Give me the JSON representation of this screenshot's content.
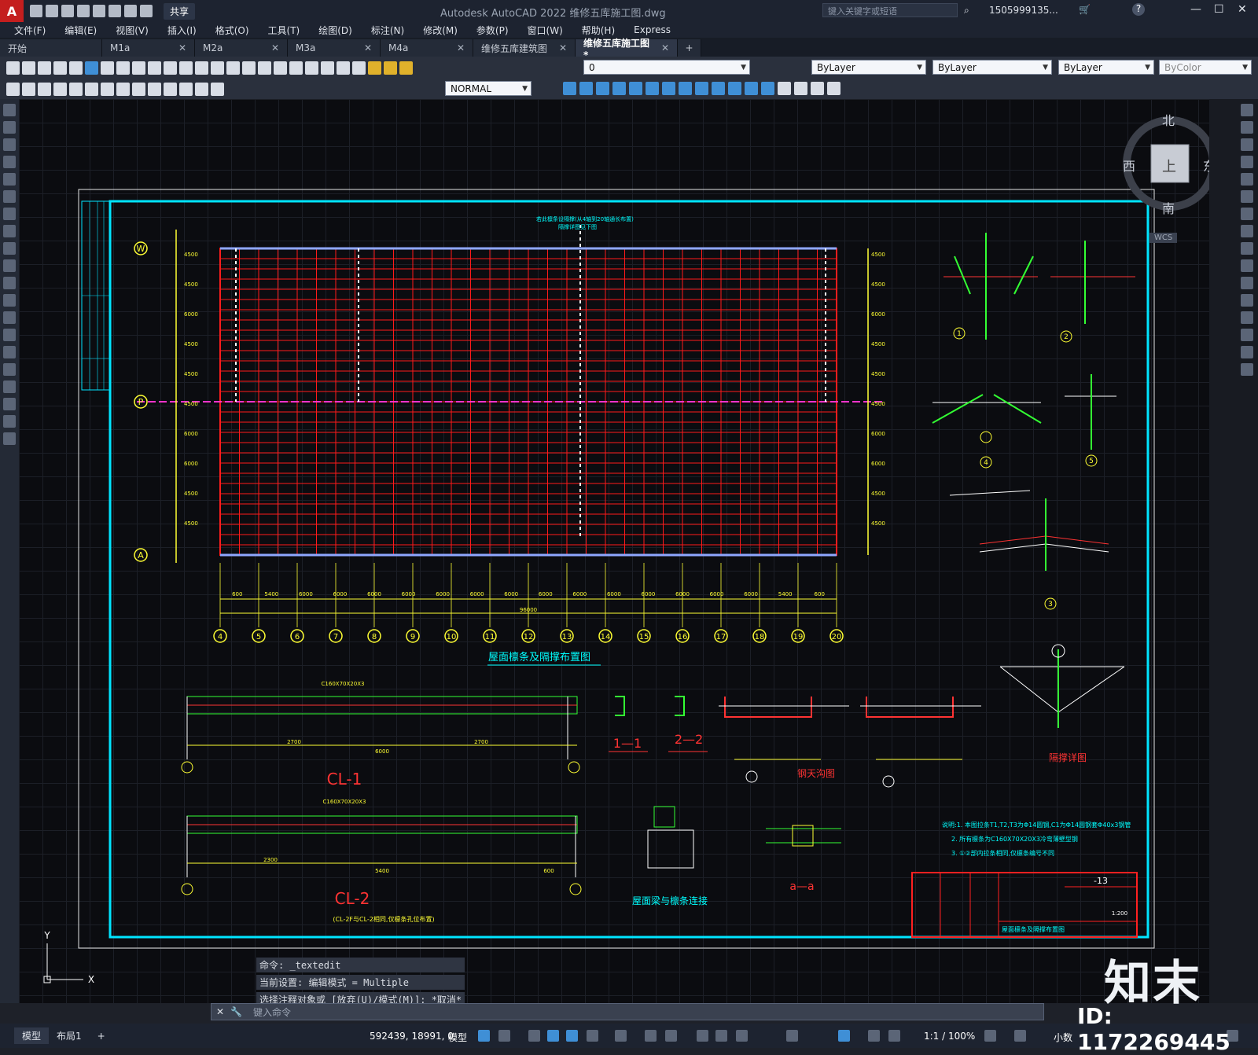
{
  "titlebar": {
    "logo": "A",
    "share": "共享",
    "title": "Autodesk AutoCAD 2022    维修五库施工图.dwg",
    "search_placeholder": "键入关键字或短语",
    "user": "1505999135...",
    "help": "?",
    "minimize": "—",
    "maximize": "☐",
    "close": "✕"
  },
  "menu": [
    "文件(F)",
    "编辑(E)",
    "视图(V)",
    "插入(I)",
    "格式(O)",
    "工具(T)",
    "绘图(D)",
    "标注(N)",
    "修改(M)",
    "参数(P)",
    "窗口(W)",
    "帮助(H)",
    "Express"
  ],
  "tabs": [
    {
      "label": "开始",
      "closable": false,
      "active": false
    },
    {
      "label": "M1a",
      "closable": true,
      "active": false
    },
    {
      "label": "M2a",
      "closable": true,
      "active": false
    },
    {
      "label": "M3a",
      "closable": true,
      "active": false
    },
    {
      "label": "M4a",
      "closable": true,
      "active": false
    },
    {
      "label": "维修五库建筑图",
      "closable": true,
      "active": false
    },
    {
      "label": "维修五库施工图*",
      "closable": true,
      "active": true
    }
  ],
  "new_tab": "+",
  "toolbar": {
    "layer": "0",
    "color": "ByLayer",
    "linetype": "ByLayer",
    "lineweight": "ByLayer",
    "plotstyle": "ByColor",
    "dimstyle": "NORMAL"
  },
  "viewcube": {
    "north": "北",
    "south": "南",
    "east": "东",
    "west": "西",
    "top": "上",
    "wcs": "WCS"
  },
  "drawing": {
    "plan_title": "屋面檩条及隔撑布置图",
    "grid_rows": [
      "W",
      "P",
      "A"
    ],
    "grid_cols": [
      "4",
      "5",
      "6",
      "7",
      "8",
      "9",
      "10",
      "11",
      "12",
      "13",
      "14",
      "15",
      "16",
      "17",
      "18",
      "19",
      "20"
    ],
    "bay_dims": [
      "600",
      "5400",
      "6000",
      "6000",
      "6000",
      "6000",
      "6000",
      "6000",
      "6000",
      "6000",
      "6000",
      "6000",
      "6000",
      "6000",
      "6000",
      "6000",
      "5400",
      "600"
    ],
    "total_dim": "96000",
    "side_dims": [
      "4500",
      "4500",
      "6000",
      "4500",
      "4500",
      "4500",
      "6000",
      "6000",
      "4500",
      "4500"
    ],
    "note_top": "若此檩条设隔撑(从4轴到20轴通长布置)",
    "note_top2": "隔撑详图见下图",
    "detail_labels": [
      "1",
      "2",
      "4",
      "5",
      "3"
    ],
    "cl1_title": "CL-1",
    "cl2_title": "CL-2",
    "cl2_note": "(CL-2F与CL-2相同,仅檩条孔位布置)",
    "sec11": "1—1",
    "sec22": "2—2",
    "secaa": "a—a",
    "gutter": "钢天沟图",
    "brace": "隔撑详图",
    "beam_conn": "屋面梁与檩条连接",
    "cl1_dims": [
      "2700",
      "2700",
      "6000"
    ],
    "cl2_dims": [
      "2300",
      "5400",
      "600"
    ],
    "purlin_spec": "C160X70X20X3",
    "notes": [
      "说明:1. 本图拉条T1,T2,T3为Φ14圆钢,C1为Φ14圆钢套Φ40x3钢管",
      "2. 所有檩条为C160X70X20X3冷弯薄壁型钢",
      "3. ①②部内拉条相同,仅檩条编号不同"
    ],
    "titleblock_no": "-13",
    "titleblock_scale": "1:200",
    "titleblock_name": "屋面檩条及隔撑布置图"
  },
  "command": {
    "lines": [
      "命令: _textedit",
      "当前设置: 编辑模式 = Multiple",
      "选择注释对象或 [放弃(U)/模式(M)]: *取消*"
    ],
    "placeholder": "键入命令"
  },
  "status": {
    "layout_tabs": [
      "模型",
      "布局1"
    ],
    "add_layout": "+",
    "coords": "592439, 18991, 0",
    "model": "模型",
    "scale": "1:1 / 100%",
    "units": "小数"
  },
  "watermark": {
    "brand": "知末",
    "id": "ID: 1172269445"
  }
}
